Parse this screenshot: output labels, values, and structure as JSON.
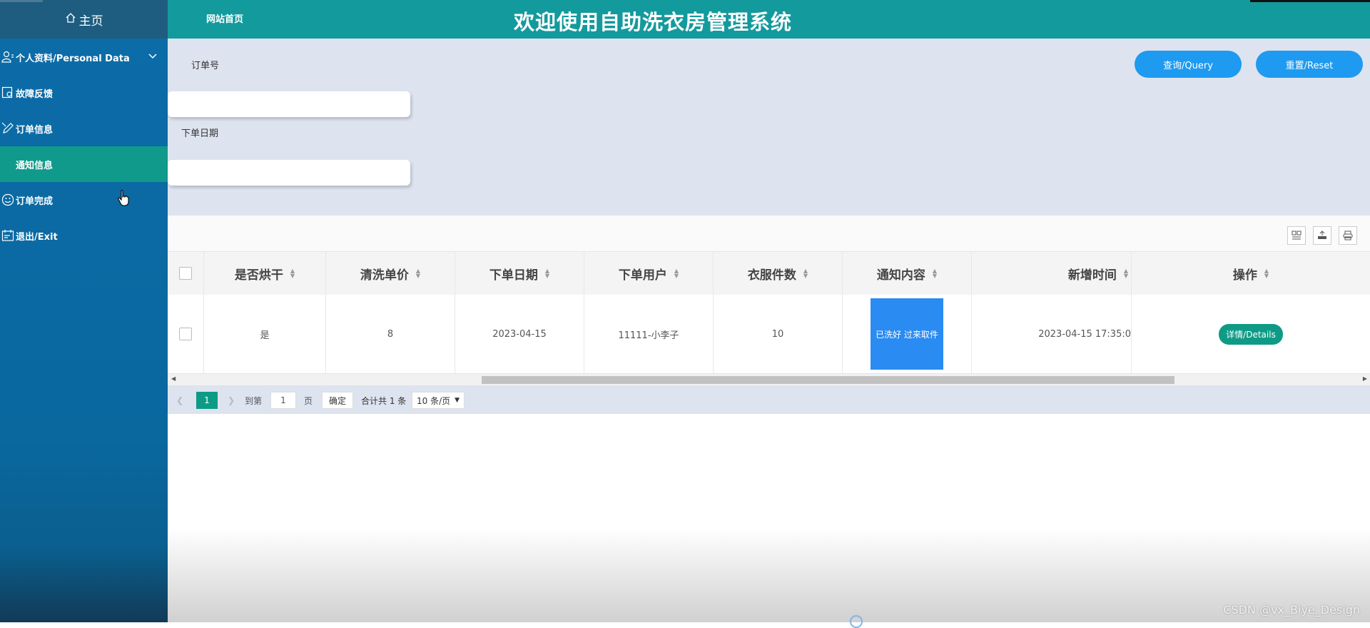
{
  "sidebar": {
    "home_label": "主页",
    "items": [
      {
        "label": "个人资料/Personal Data",
        "icon": "user-icon"
      },
      {
        "label": "故障反馈",
        "icon": "gear-icon"
      },
      {
        "label": "订单信息",
        "icon": "edit-icon"
      },
      {
        "label": "通知信息",
        "icon": "",
        "active": true
      },
      {
        "label": "订单完成",
        "icon": "smiley-icon"
      },
      {
        "label": "退出/Exit",
        "icon": "calendar-icon"
      }
    ]
  },
  "header": {
    "site_home": "网站首页",
    "title": "欢迎使用自助洗衣房管理系统"
  },
  "search": {
    "order_no_label": "订单号",
    "order_date_label": "下单日期",
    "query_button": "查询/Query",
    "reset_button": "重置/Reset"
  },
  "table": {
    "columns": [
      "是否烘干",
      "清洗单价",
      "下单日期",
      "下单用户",
      "衣服件数",
      "通知内容",
      "新增时间",
      "操作"
    ],
    "rows": [
      {
        "dried": "是",
        "price": "8",
        "order_date": "2023-04-15",
        "user": "11111-小李子",
        "count": "10",
        "notice": "已洗好 过来取件",
        "created": "2023-04-15 17:35:0",
        "action": "详情/Details"
      }
    ]
  },
  "pager": {
    "current": "1",
    "goto_prefix": "到第",
    "goto_value": "1",
    "goto_suffix": "页",
    "confirm": "确定",
    "total": "合计共 1 条",
    "page_size": "10 条/页"
  },
  "watermark": "CSDN @vx_Biye_Design",
  "colors": {
    "sidebar": "#0c6ca8",
    "header": "#139a9d",
    "active_item": "#0f9a8c",
    "button_blue": "#1e9af0",
    "button_green": "#0e9b86",
    "notice_bg": "#2a8bf2"
  }
}
